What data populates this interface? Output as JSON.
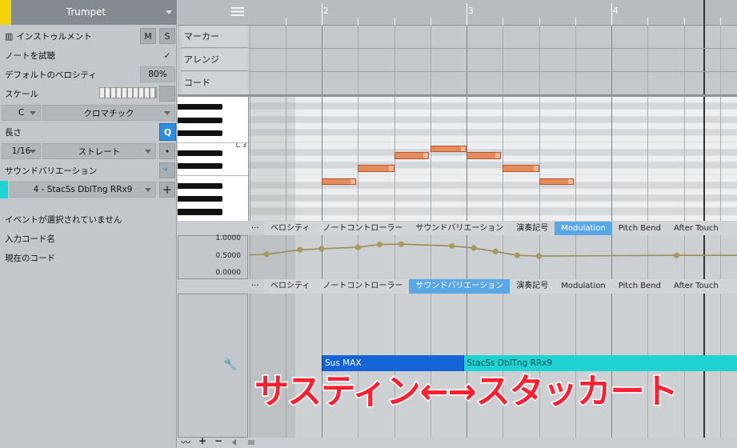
{
  "track": {
    "name": "Trumpet"
  },
  "inspector": {
    "instrument_label": "インストゥルメント",
    "m_label": "M",
    "s_label": "S",
    "audition_label": "ノートを試聴",
    "audition_check": "✓",
    "default_velocity_label": "デフォルトのベロシティ",
    "default_velocity_value": "80%",
    "scale_label": "スケール",
    "key_value": "C",
    "scale_value": "クロマチック",
    "length_label": "長さ",
    "q_label": "Q",
    "quantize_value": "1/16",
    "straight_value": "ストレート",
    "sound_variation_label": "サウンドバリエーション",
    "variation_value": "4 - StacSs DblTng RRx9",
    "plus": "+",
    "no_event": "イベントが選択されていません",
    "input_chord_label": "入力コード名",
    "current_chord_label": "現在のコード"
  },
  "ruler": {
    "bars": [
      "2",
      "3",
      "4"
    ]
  },
  "tracklanes": {
    "marker": "マーカー",
    "arrange": "アレンジ",
    "chord": "コード"
  },
  "keyboard": {
    "c3_label": "C 3"
  },
  "tabs_top": [
    "ベロシティ",
    "ノートコントローラー",
    "サウンドバリエーション",
    "演奏記号",
    "Modulation",
    "Pitch Bend",
    "After Touch"
  ],
  "tabs_top_selected": 4,
  "tabs_bottom": [
    "ベロシティ",
    "ノートコントローラー",
    "サウンドバリエーション",
    "演奏記号",
    "Modulation",
    "Pitch Bend",
    "After Touch"
  ],
  "tabs_bottom_selected": 2,
  "more_dots": "...",
  "mod_scale": {
    "top": "1.0000",
    "mid": "0.5000",
    "bottom": "0.0000"
  },
  "modulation_points": [
    [
      1.35,
      0.54
    ],
    [
      1.62,
      0.57
    ],
    [
      1.85,
      0.7
    ],
    [
      2.0,
      0.73
    ],
    [
      2.25,
      0.77
    ],
    [
      2.4,
      0.85
    ],
    [
      2.55,
      0.86
    ],
    [
      2.9,
      0.81
    ],
    [
      3.05,
      0.75
    ],
    [
      3.2,
      0.65
    ],
    [
      3.35,
      0.54
    ],
    [
      3.5,
      0.52
    ],
    [
      4.45,
      0.54
    ]
  ],
  "variation_bars": [
    {
      "label": "Sus MAX",
      "color": "#1565d8"
    },
    {
      "label": "StacSs DblTng RRx9",
      "color": "#1fd3d3"
    }
  ],
  "caption": "サスティン←→スタッカート",
  "colors": {
    "accent": "#5aa7e8",
    "track_color": "#f3d20c",
    "note": "#e58a5a",
    "caption": "#ff1f2e"
  }
}
